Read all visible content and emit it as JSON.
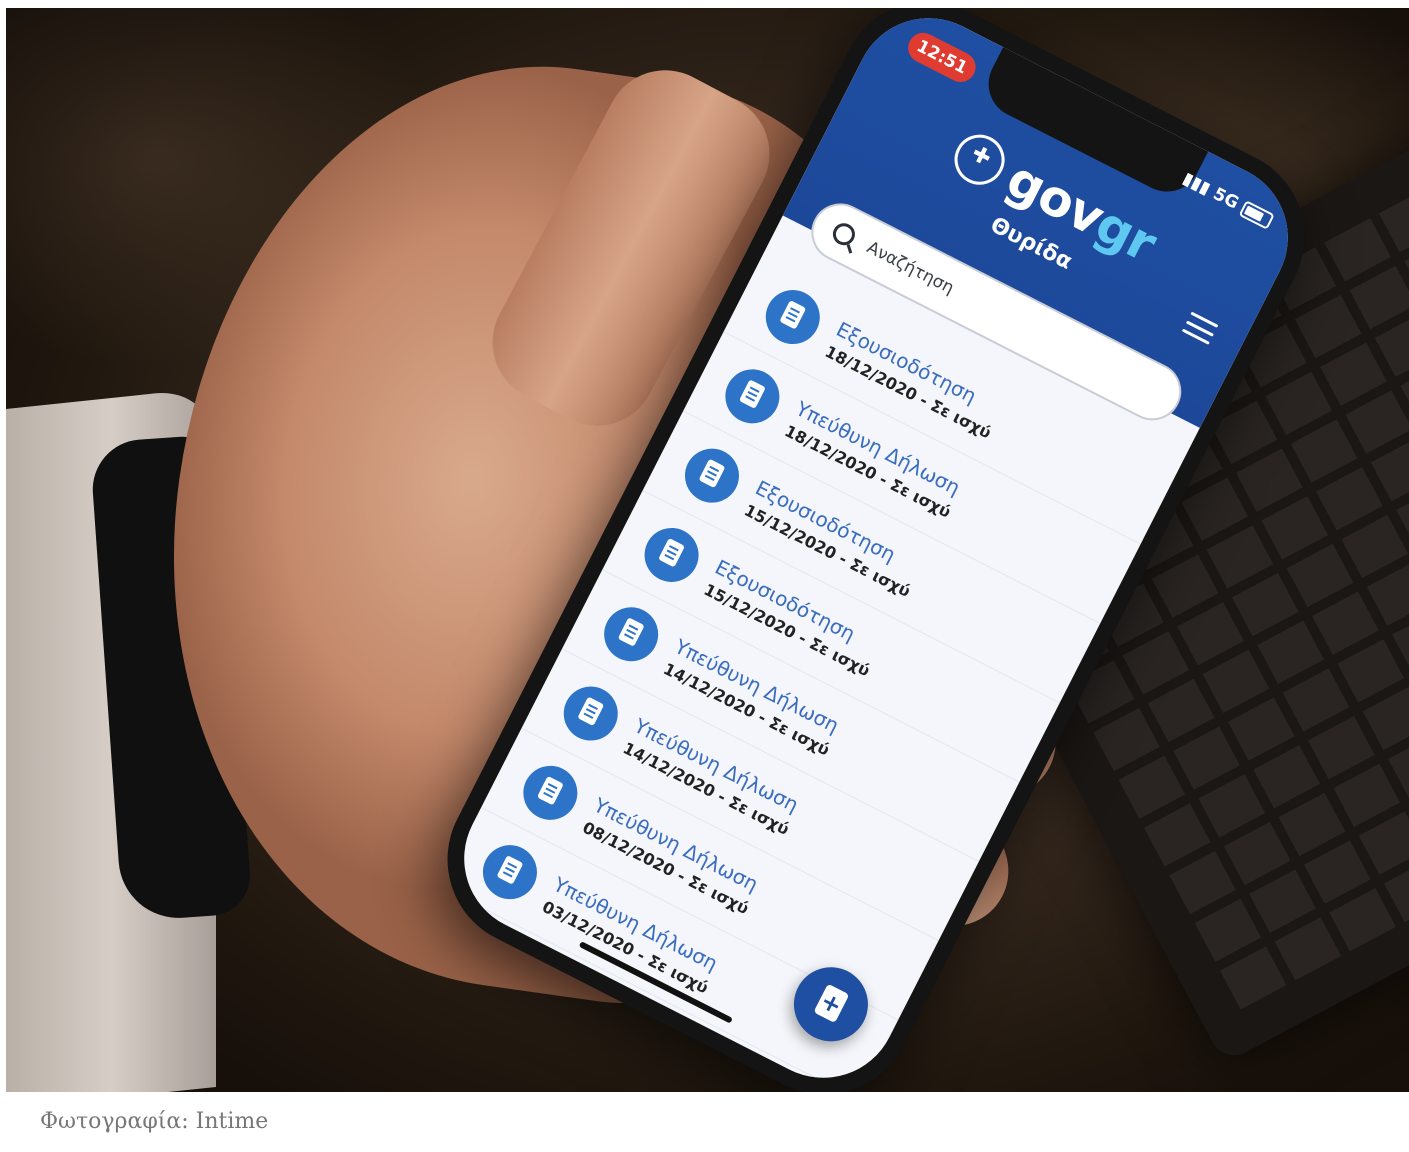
{
  "status_bar": {
    "time": "12:51",
    "network": "5G"
  },
  "app": {
    "logo_gov": "gov",
    "logo_gr": "gr",
    "page_title": "Θυρίδα"
  },
  "search": {
    "placeholder": "Αναζήτηση"
  },
  "documents": [
    {
      "title": "Εξουσιοδότηση",
      "subtitle": "18/12/2020 - Σε ισχύ"
    },
    {
      "title": "Υπεύθυνη Δήλωση",
      "subtitle": "18/12/2020 - Σε ισχύ"
    },
    {
      "title": "Εξουσιοδότηση",
      "subtitle": "15/12/2020 - Σε ισχύ"
    },
    {
      "title": "Εξουσιοδότηση",
      "subtitle": "15/12/2020 - Σε ισχύ"
    },
    {
      "title": "Υπεύθυνη Δήλωση",
      "subtitle": "14/12/2020 - Σε ισχύ"
    },
    {
      "title": "Υπεύθυνη Δήλωση",
      "subtitle": "14/12/2020 - Σε ισχύ"
    },
    {
      "title": "Υπεύθυνη Δήλωση",
      "subtitle": "08/12/2020 - Σε ισχύ"
    },
    {
      "title": "Υπεύθυνη Δήλωση",
      "subtitle": "03/12/2020 - Σε ισχύ"
    }
  ],
  "icons": {
    "document": "document-icon",
    "search": "search-icon",
    "menu": "hamburger-menu-icon",
    "fab": "new-document-plus-icon",
    "emblem": "greek-emblem-icon"
  },
  "colors": {
    "header_blue": "#1f4fa2",
    "accent_light_blue": "#5fc8f0",
    "item_blue": "#2d73c7",
    "time_badge_red": "#e03b30"
  },
  "caption": "Φωτογραφία: Intime"
}
